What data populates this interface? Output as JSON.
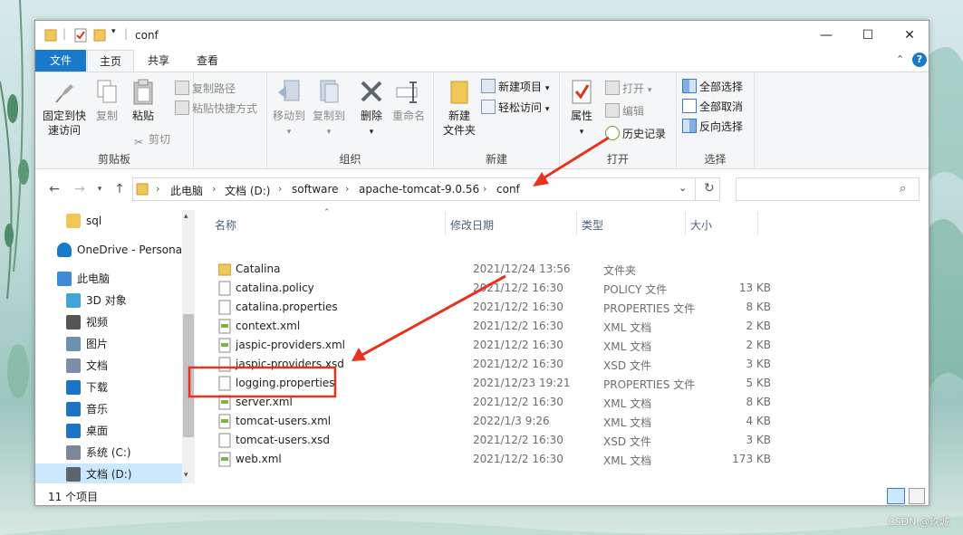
{
  "window": {
    "title": "conf",
    "controls": [
      "minimize-icon",
      "maximize-icon",
      "close-icon"
    ]
  },
  "ribbon_tabs": [
    "文件",
    "主页",
    "共享",
    "查看"
  ],
  "ribbon": {
    "clipboard": {
      "pin": "固定到快速访问",
      "pin_line1": "固定到快",
      "pin_line2": "速访问",
      "copy": "复制",
      "paste": "粘贴",
      "copy_path": "复制路径",
      "paste_shortcut": "粘贴快捷方式",
      "cut": "剪切",
      "label": "剪贴板"
    },
    "organize": {
      "move_to": "移动到",
      "copy_to": "复制到",
      "delete": "删除",
      "rename": "重命名",
      "label": "组织"
    },
    "new": {
      "new_folder_line1": "新建",
      "new_folder_line2": "文件夹",
      "new_item": "新建项目",
      "easy_access": "轻松访问",
      "label": "新建"
    },
    "open": {
      "properties": "属性",
      "open": "打开",
      "edit": "编辑",
      "history": "历史记录",
      "label": "打开"
    },
    "select": {
      "select_all": "全部选择",
      "select_none": "全部取消",
      "invert": "反向选择",
      "label": "选择"
    }
  },
  "address": {
    "crumbs": [
      "此电脑",
      "文档 (D:)",
      "software",
      "apache-tomcat-9.0.56",
      "conf"
    ],
    "search_placeholder": ""
  },
  "nav_pane": [
    {
      "label": "sql",
      "icon": "folder-icon"
    },
    {
      "label": "OneDrive - Persona",
      "icon": "onedrive-icon"
    },
    {
      "label": "此电脑",
      "icon": "computer-icon"
    },
    {
      "label": "3D 对象",
      "icon": "3d-objects-icon"
    },
    {
      "label": "视频",
      "icon": "video-icon"
    },
    {
      "label": "图片",
      "icon": "pictures-icon"
    },
    {
      "label": "文档",
      "icon": "documents-icon"
    },
    {
      "label": "下载",
      "icon": "download-icon"
    },
    {
      "label": "音乐",
      "icon": "music-icon"
    },
    {
      "label": "桌面",
      "icon": "desktop-icon"
    },
    {
      "label": "系统 (C:)",
      "icon": "drive-c-icon"
    },
    {
      "label": "文档 (D:)",
      "icon": "drive-d-icon"
    }
  ],
  "columns": {
    "name": "名称",
    "date": "修改日期",
    "type": "类型",
    "size": "大小"
  },
  "files": [
    {
      "name": "Catalina",
      "date": "2021/12/24 13:56",
      "type": "文件夹",
      "size": "",
      "icon": "folder-icon"
    },
    {
      "name": "catalina.policy",
      "date": "2021/12/2 16:30",
      "type": "POLICY 文件",
      "size": "13 KB",
      "icon": "file-icon"
    },
    {
      "name": "catalina.properties",
      "date": "2021/12/2 16:30",
      "type": "PROPERTIES 文件",
      "size": "8 KB",
      "icon": "file-icon"
    },
    {
      "name": "context.xml",
      "date": "2021/12/2 16:30",
      "type": "XML 文档",
      "size": "2 KB",
      "icon": "xml-file-icon"
    },
    {
      "name": "jaspic-providers.xml",
      "date": "2021/12/2 16:30",
      "type": "XML 文档",
      "size": "2 KB",
      "icon": "xml-file-icon"
    },
    {
      "name": "jaspic-providers.xsd",
      "date": "2021/12/2 16:30",
      "type": "XSD 文件",
      "size": "3 KB",
      "icon": "file-icon"
    },
    {
      "name": "logging.properties",
      "date": "2021/12/23 19:21",
      "type": "PROPERTIES 文件",
      "size": "5 KB",
      "icon": "file-icon"
    },
    {
      "name": "server.xml",
      "date": "2021/12/2 16:30",
      "type": "XML 文档",
      "size": "8 KB",
      "icon": "xml-file-icon"
    },
    {
      "name": "tomcat-users.xml",
      "date": "2022/1/3 9:26",
      "type": "XML 文档",
      "size": "4 KB",
      "icon": "xml-file-icon"
    },
    {
      "name": "tomcat-users.xsd",
      "date": "2021/12/2 16:30",
      "type": "XSD 文件",
      "size": "3 KB",
      "icon": "file-icon"
    },
    {
      "name": "web.xml",
      "date": "2021/12/2 16:30",
      "type": "XML 文档",
      "size": "173 KB",
      "icon": "xml-file-icon"
    }
  ],
  "status": {
    "count": "11 个项目"
  },
  "watermark": "CSDN @玖城",
  "colors": {
    "accent": "#1979ca",
    "annotation_red": "#e8321e",
    "folder_yellow": "#f1c75a"
  }
}
